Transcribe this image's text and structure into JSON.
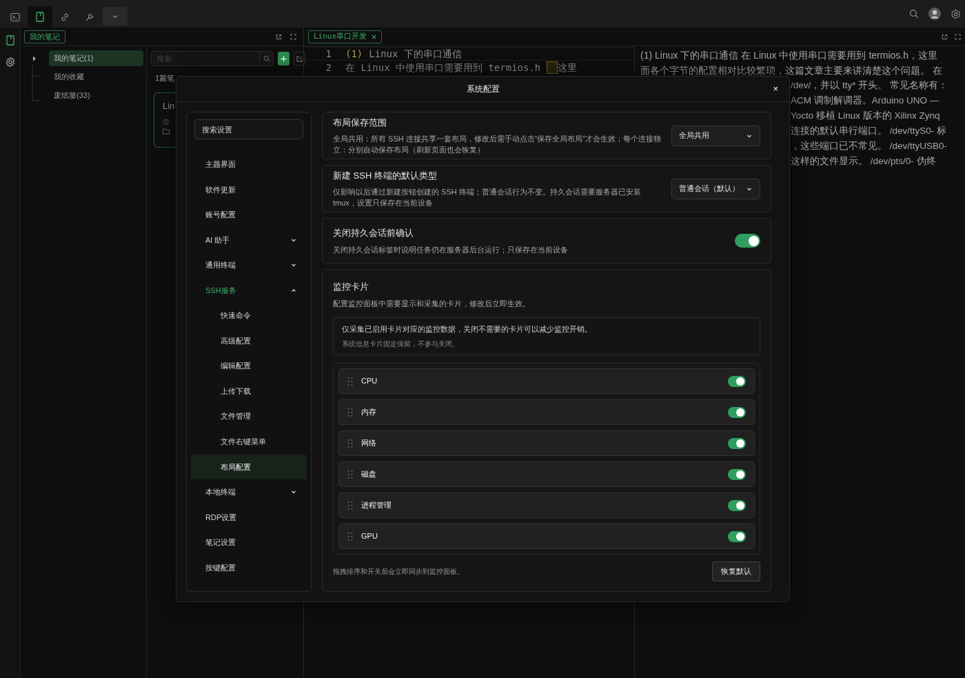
{
  "activity_bar": {
    "tabs": [
      {
        "kind": "terminal",
        "selected": false
      },
      {
        "kind": "notes",
        "selected": true
      },
      {
        "kind": "link",
        "selected": false
      },
      {
        "kind": "tools",
        "selected": false
      },
      {
        "kind": "more",
        "selected": false
      }
    ]
  },
  "side_rail": [
    {
      "kind": "notes",
      "selected": true
    },
    {
      "kind": "settings",
      "selected": false
    }
  ],
  "notes_panel": {
    "tab": "我的笔记",
    "tree": [
      {
        "label": "我的笔记(1)",
        "selected": true
      },
      {
        "label": "我的收藏",
        "selected": false
      },
      {
        "label": "废纸篓(33)",
        "selected": false
      }
    ],
    "search": {
      "placeholder": "搜索"
    },
    "count": "1篇笔",
    "card_title": "Lin"
  },
  "document": {
    "tab": "Linux串口开发",
    "editor_lines": [
      {
        "number": "1",
        "marker": "(1)",
        "text": "Linux 下的串口通信"
      },
      {
        "number": "2",
        "text": "在 Linux 中使用串口需要用到 termios.h",
        "after_cursor": "这里"
      }
    ],
    "preview_lines": [
      "(1) Linux 下的串口通信 在 Linux 中使用串口需要用到 termios.h，这里",
      "面各个字节的配置相对比较繁琐，这篇文章主要来讲清楚这个问题。 在"
    ],
    "preview_cut_lines": [
      "/dev/，并以 tty* 开头。 常见名称有：",
      "ACM 调制解调器。Arduino UNO —",
      "Yocto 移植 Linux 版本的 Xilinx Zynq",
      "连接的默认串行端口。 /dev/ttyS0- 标",
      "，这些端口已不常见。 /dev/ttyUSB0-",
      "这样的文件显示。 /dev/pts/0- 伪终"
    ]
  },
  "dialog": {
    "title": "系统配置",
    "close": "×",
    "search": {
      "placeholder": "搜索设置"
    },
    "nav": [
      {
        "label": "主题界面",
        "kind": "link",
        "selected": false
      },
      {
        "label": "软件更新",
        "kind": "link",
        "selected": false
      },
      {
        "label": "账号配置",
        "kind": "link",
        "selected": false
      },
      {
        "label": "AI 助手",
        "kind": "group",
        "expanded": false
      },
      {
        "label": "通用终端",
        "kind": "group",
        "expanded": false
      },
      {
        "label": "SSH服务",
        "kind": "group",
        "expanded": true,
        "children": [
          {
            "label": "快速命令",
            "selected": false
          },
          {
            "label": "高级配置",
            "selected": false
          },
          {
            "label": "编辑配置",
            "selected": false
          },
          {
            "label": "上传下载",
            "selected": false
          },
          {
            "label": "文件管理",
            "selected": false
          },
          {
            "label": "文件右键菜单",
            "selected": false
          },
          {
            "label": "布局配置",
            "selected": true
          }
        ]
      },
      {
        "label": "本地终端",
        "kind": "group",
        "expanded": false
      },
      {
        "label": "RDP设置",
        "kind": "link",
        "selected": false
      },
      {
        "label": "笔记设置",
        "kind": "link",
        "selected": false
      },
      {
        "label": "按键配置",
        "kind": "link",
        "selected": false
      }
    ],
    "sections": [
      {
        "kind": "select",
        "title": "布局保存范围",
        "description": "全局共用：所有 SSH 连接共享一套布局，修改后需手动点击“保存全局布局”才会生效；每个连接独立：分别自动保存布局（刷新页面也会恢复）",
        "value": "全局共用"
      },
      {
        "kind": "select",
        "title": "新建 SSH 终端的默认类型",
        "description": "仅影响以后通过新建按钮创建的 SSH 终端；普通会话行为不变。持久会话需要服务器已安装 tmux，设置只保存在当前设备",
        "value": "普通会话（默认）"
      },
      {
        "kind": "toggle",
        "title": "关闭持久会话前确认",
        "description": "关闭持久会话标签时说明任务仍在服务器后台运行；只保存在当前设备",
        "on": true
      },
      {
        "kind": "cards",
        "title": "监控卡片",
        "description": "配置监控面板中需要显示和采集的卡片，修改后立即生效。",
        "notice": "仅采集已启用卡片对应的监控数据，关闭不需要的卡片可以减少监控开销。",
        "note": "系统信息卡片固定保留，不参与关闭。",
        "cards": [
          {
            "label": "CPU",
            "on": true
          },
          {
            "label": "内存",
            "on": true
          },
          {
            "label": "网络",
            "on": true
          },
          {
            "label": "磁盘",
            "on": true
          },
          {
            "label": "进程管理",
            "on": true
          },
          {
            "label": "GPU",
            "on": true
          }
        ],
        "footer": "拖拽排序和开关后会立即同步到监控面板。",
        "reset": "恢复默认"
      }
    ]
  }
}
